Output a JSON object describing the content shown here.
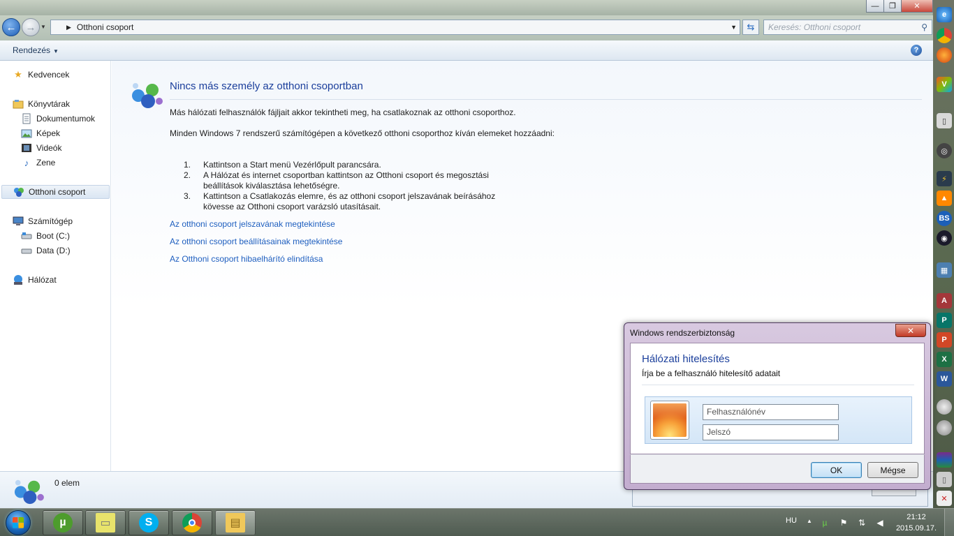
{
  "window": {
    "address": "Otthoni csoport",
    "search_placeholder": "Keresés: Otthoni csoport",
    "minimize": "—",
    "maximize": "❐",
    "close": "✕"
  },
  "command_bar": {
    "organize": "Rendezés"
  },
  "nav": {
    "favorites": "Kedvencek",
    "libraries": "Könyvtárak",
    "lib_items": [
      "Dokumentumok",
      "Képek",
      "Videók",
      "Zene"
    ],
    "homegroup": "Otthoni csoport",
    "computer": "Számítógép",
    "drives": [
      "Boot (C:)",
      "Data (D:)"
    ],
    "network": "Hálózat"
  },
  "content": {
    "heading": "Nincs más személy az otthoni csoportban",
    "para1": "Más hálózati felhasználók fájljait akkor tekintheti meg, ha csatlakoznak az otthoni csoporthoz.",
    "para2": "Minden Windows 7 rendszerű számítógépen a következő otthoni csoporthoz kíván elemeket hozzáadni:",
    "steps": [
      {
        "num": "1.",
        "text": "Kattintson a Start menü Vezérlőpult parancsára."
      },
      {
        "num": "2.",
        "text": "A Hálózat és internet csoportban kattintson az Otthoni csoport és megosztási beállítások kiválasztása lehetőségre."
      },
      {
        "num": "3.",
        "text": "Kattintson a Csatlakozás elemre, és az otthoni csoport jelszavának beírásához kövesse az Otthoni csoport varázsló utasításait."
      }
    ],
    "links": [
      "Az otthoni csoport jelszavának megtekintése",
      "Az otthoni csoport beállításainak megtekintése",
      "Az Otthoni csoport hibaelhárító elindítása"
    ]
  },
  "details": {
    "count": "0 elem"
  },
  "dialog": {
    "title": "Windows rendszerbiztonság",
    "heading": "Hálózati hitelesítés",
    "subtitle": "Írja be a felhasználó hitelesítő adatait",
    "username_placeholder": "Felhasználónév",
    "password_placeholder": "Jelszó",
    "ok": "OK",
    "cancel": "Mégse",
    "close": "✕"
  },
  "taskbar": {
    "language": "HU",
    "time": "21:12",
    "date": "2015.09.17."
  },
  "colors": {
    "link": "#1f5fbf",
    "heading": "#1a3e9b"
  }
}
